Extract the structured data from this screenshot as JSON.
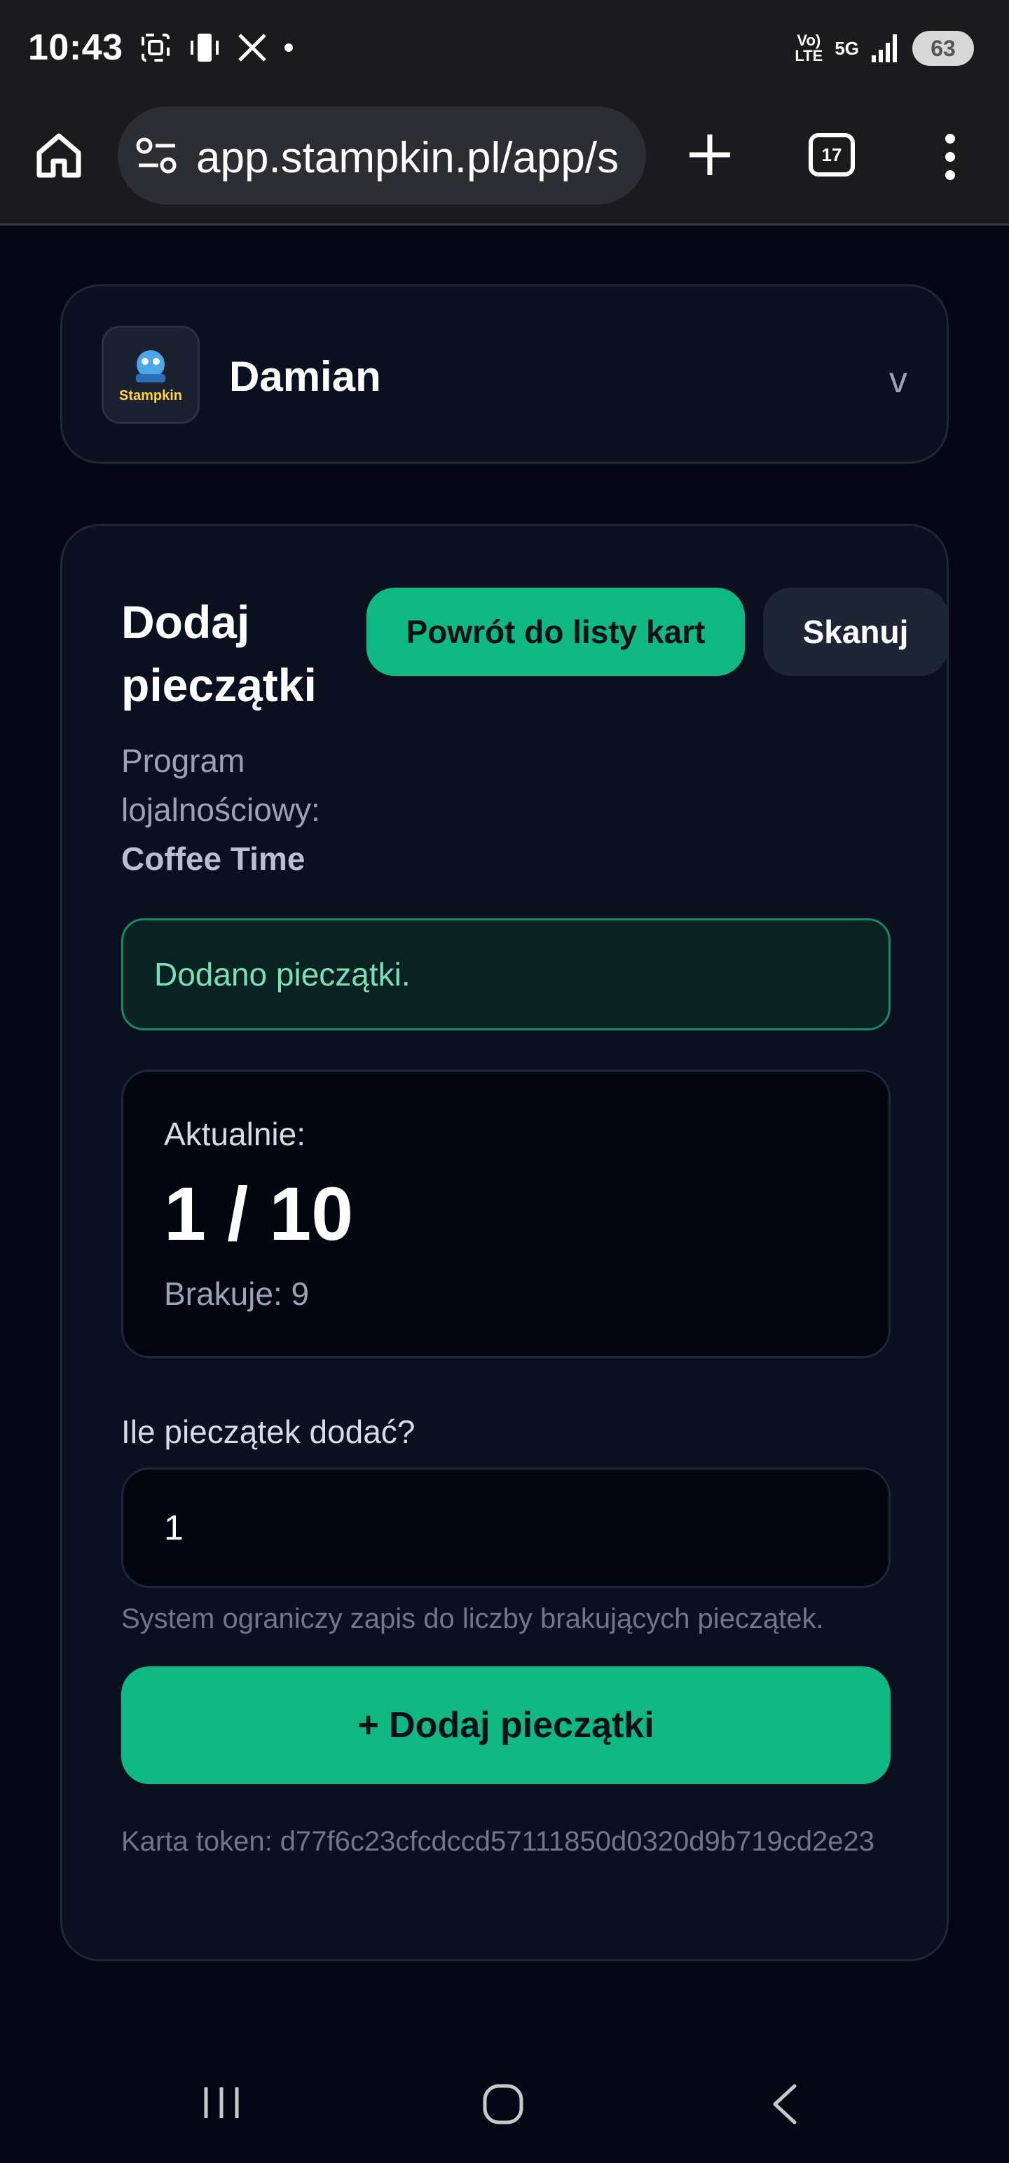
{
  "status_bar": {
    "time": "10:43",
    "network_volte": "Vo) LTE",
    "network_5g": "5G",
    "battery": "63"
  },
  "browser": {
    "url": "app.stampkin.pl/app/s",
    "tab_count": "17"
  },
  "profile": {
    "avatar_text": "Stampkin",
    "name": "Damian",
    "toggle": "v"
  },
  "page": {
    "title": "Dodaj pieczątki",
    "back_button": "Powrót do listy kart",
    "scan_button": "Skanuj",
    "program_label": "Program lojalnościowy:",
    "program_name": "Coffee Time",
    "alert": "Dodano pieczątki.",
    "current_label": "Aktualnie:",
    "current_count": "1 / 10",
    "missing": "Brakuje: 9",
    "progress": {
      "current": 1,
      "total": 10
    },
    "question": "Ile pieczątek dodać?",
    "quantity_value": "1",
    "hint": "System ograniczy zapis do liczby brakujących pieczątek.",
    "add_button": "+ Dodaj pieczątki",
    "token": "Karta token: d77f6c23cfcdccd57111850d0320d9b719cd2e23"
  },
  "colors": {
    "accent": "#10b981",
    "background": "#050814",
    "card": "#0b1020",
    "alert_text": "#79e0b6"
  }
}
